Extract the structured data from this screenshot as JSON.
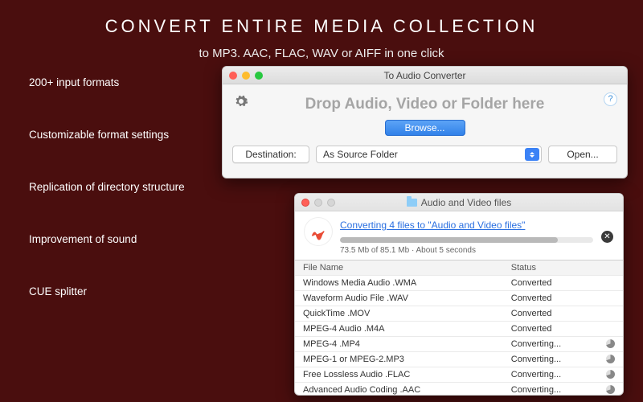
{
  "headline": "CONVERT  ENTIRE  MEDIA  COLLECTION",
  "subhead": "to MP3. AAC, FLAC, WAV or AIFF in one click",
  "features": [
    "200+ input formats",
    "Customizable format settings",
    "Replication of directory structure",
    "Improvement of sound",
    "CUE splitter"
  ],
  "main_window": {
    "title": "To Audio Converter",
    "drop_text": "Drop Audio, Video or Folder here",
    "browse": "Browse...",
    "dest_label": "Destination:",
    "dest_value": "As Source Folder",
    "open": "Open...",
    "help": "?"
  },
  "progress_window": {
    "title": "Audio and Video files",
    "link": "Converting 4 files to \"Audio and Video files\"",
    "stat": "73.5 Mb of 85.1 Mb · About 5 seconds",
    "progress_pct": 86,
    "columns": {
      "file": "File Name",
      "status": "Status"
    },
    "rows": [
      {
        "file": "Windows Media Audio .WMA",
        "status": "Converted",
        "busy": false
      },
      {
        "file": "Waveform Audio File .WAV",
        "status": "Converted",
        "busy": false
      },
      {
        "file": "QuickTime .MOV",
        "status": "Converted",
        "busy": false
      },
      {
        "file": "MPEG-4 Audio .M4A",
        "status": "Converted",
        "busy": false
      },
      {
        "file": "MPEG-4 .MP4",
        "status": "Converting...",
        "busy": true
      },
      {
        "file": "MPEG-1 or MPEG-2.MP3",
        "status": "Converting...",
        "busy": true
      },
      {
        "file": "Free Lossless Audio .FLAC",
        "status": "Converting...",
        "busy": true
      },
      {
        "file": "Advanced Audio Coding .AAC",
        "status": "Converting...",
        "busy": true
      }
    ]
  }
}
